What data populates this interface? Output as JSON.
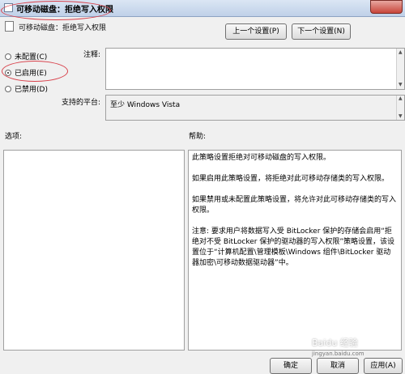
{
  "window": {
    "title": "可移动磁盘：拒绝写入权限"
  },
  "header": {
    "policy_name": "可移动磁盘：拒绝写入权限",
    "prev_button": "上一个设置(P)",
    "next_button": "下一个设置(N)"
  },
  "state": {
    "options": [
      {
        "label": "未配置(C)",
        "checked": false
      },
      {
        "label": "已启用(E)",
        "checked": true
      },
      {
        "label": "已禁用(D)",
        "checked": false
      }
    ]
  },
  "comment": {
    "label": "注释:",
    "value": ""
  },
  "platform": {
    "label": "支持的平台:",
    "value": "至少 Windows Vista"
  },
  "options_pane": {
    "label": "选项:"
  },
  "help_pane": {
    "label": "帮助:",
    "paragraphs": [
      "此策略设置拒绝对可移动磁盘的写入权限。",
      "如果启用此策略设置，将拒绝对此可移动存储类的写入权限。",
      "如果禁用或未配置此策略设置，将允许对此可移动存储类的写入权限。",
      "注意: 要求用户将数据写入受 BitLocker 保护的存储会启用“拒绝对不受 BitLocker 保护的驱动器的写入权限”策略设置，该设置位于“计算机配置\\管理模板\\Windows 组件\\BitLocker 驱动器加密\\可移动数据驱动器”中。"
    ]
  },
  "footer": {
    "ok_button": "确定",
    "cancel_button": "取消",
    "apply_button": "应用(A)"
  },
  "watermark": {
    "text": "Baidu 经验",
    "url": "jingyan.baidu.com"
  },
  "colors": {
    "annotation": "#d8404a",
    "titlebar": "#c9d8ee"
  }
}
